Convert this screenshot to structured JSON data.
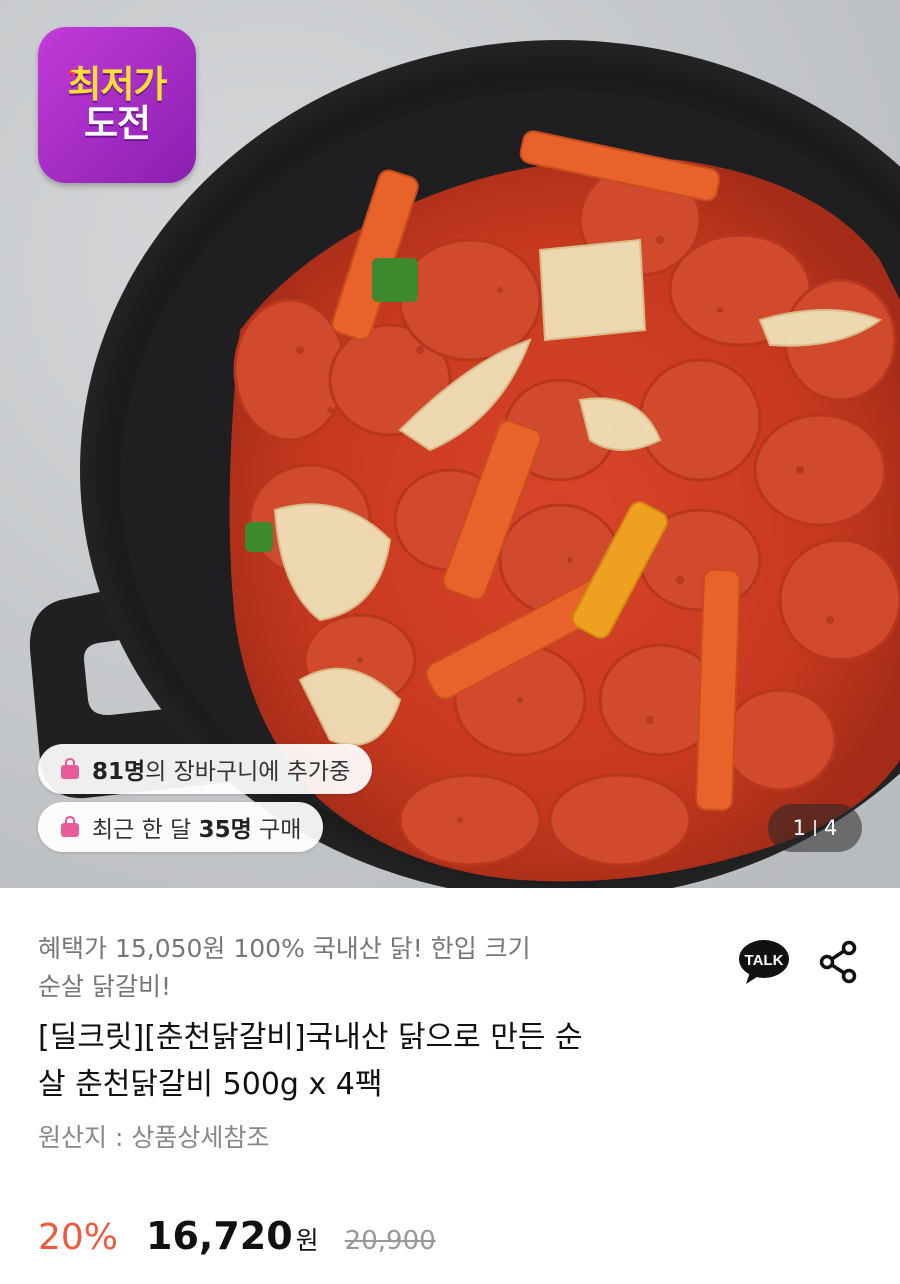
{
  "hero": {
    "badge": {
      "line1": "최저가",
      "line2": "도전"
    },
    "cart_pill": {
      "strong": "81명",
      "text": "의 장바구니에 추가중"
    },
    "purchase_pill": {
      "prefix": "최근 한 달 ",
      "strong": "35명",
      "suffix": " 구매"
    },
    "counter": {
      "current": "1",
      "total": "4"
    }
  },
  "product": {
    "subtitle_line1": "혜택가 15,050원 100% 국내산 닭! 한입 크기",
    "subtitle_line2": "순살 닭갈비!",
    "title_line1": "[딜크릿][춘천닭갈비]국내산 닭으로 만든 순",
    "title_line2": "살 춘천닭갈비 500g x 4팩",
    "origin": "원산지 : 상품상세참조"
  },
  "tools": {
    "talk_label": "TALK"
  },
  "price": {
    "discount": "20%",
    "sale_price": "16,720",
    "currency": "원",
    "original_price": "20,900"
  },
  "colors": {
    "discount": "#ee5a3f",
    "badge": "#b12fcf",
    "badge_text_accent": "#ffe135",
    "cart_icon": "#e85c9a"
  }
}
